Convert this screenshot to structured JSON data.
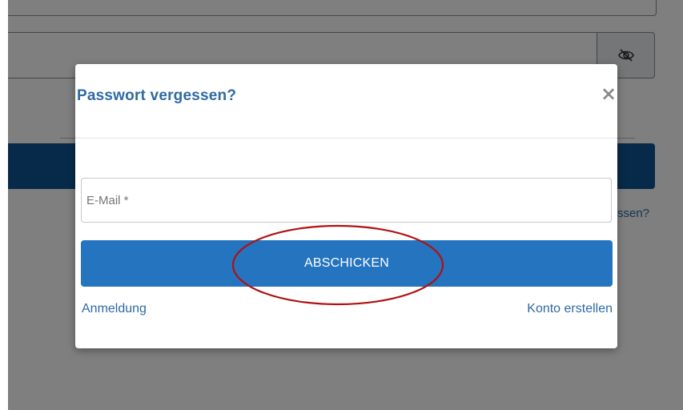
{
  "modal": {
    "title": "Passwort vergessen?",
    "close_label": "×",
    "email_placeholder": "E-Mail *",
    "email_value": "",
    "submit_label": "ABSCHICKEN",
    "login_link": "Anmeldung",
    "register_link": "Konto erstellen"
  },
  "background": {
    "forgot_link_partial": "ssen?",
    "eye_icon": "eye-slash-icon"
  },
  "colors": {
    "title": "#2f6aa3",
    "submit_button": "#2474c0",
    "links": "#2e6aa5",
    "background_button": "#0e5494",
    "annotation_circle": "#b01010"
  }
}
